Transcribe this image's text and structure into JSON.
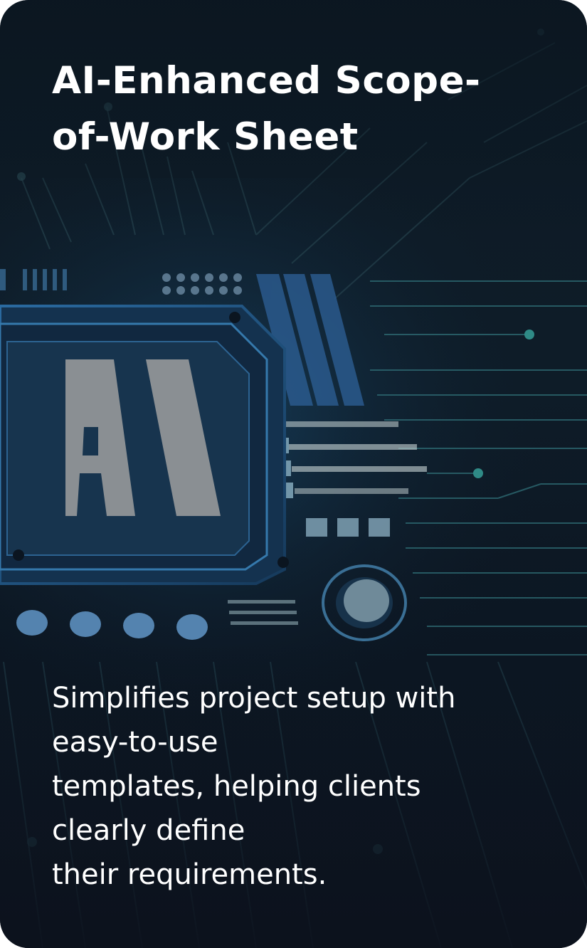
{
  "card": {
    "title": "AI-Enhanced Scope-of-Work Sheet",
    "description_lines": [
      "Simplifies project setup with",
      "easy-to-use",
      "templates, helping clients",
      "clearly define",
      "their requirements."
    ],
    "chip_label": "AI",
    "colors": {
      "background": "#0d1a25",
      "text": "#ffffff",
      "circuit": "#2f6e76",
      "chip_face": "#8a8f93"
    }
  }
}
